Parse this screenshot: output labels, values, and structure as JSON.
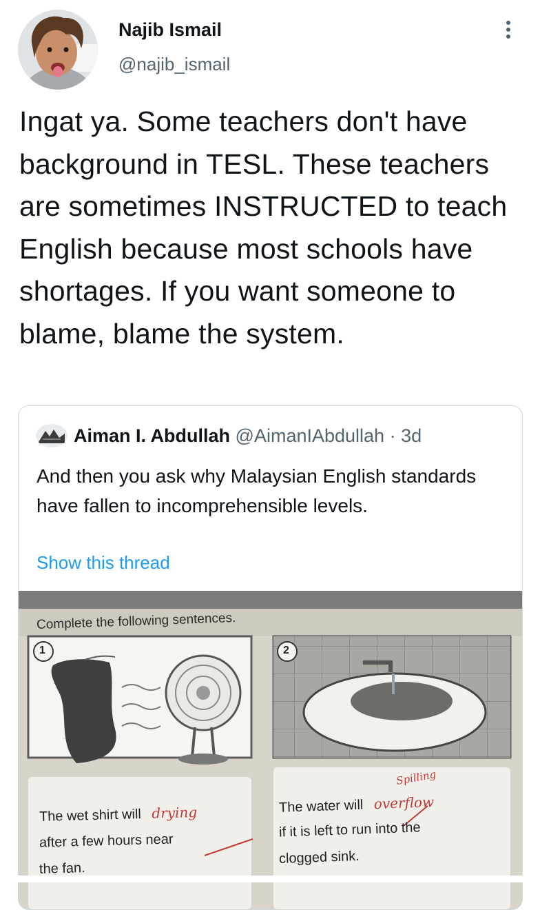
{
  "author": {
    "name": "Najib Ismail",
    "handle": "@najib_ismail"
  },
  "tweet": {
    "text": "Ingat ya. Some teachers don't have background in TESL. These teachers are sometimes INSTRUCTED to teach English because most schools have shortages. If you want someone to blame, blame the system."
  },
  "quoted": {
    "name": "Aiman I. Abdullah",
    "handle": "@AimanIAbdullah",
    "time": "· 3d",
    "text": "And then you ask why Malaysian English standards have fallen to incomprehensible levels.",
    "show_thread": "Show this thread"
  },
  "worksheet": {
    "instruction": "Complete the following sentences.",
    "item1_num": "1",
    "item2_num": "2",
    "s1_a": "The wet shirt will",
    "s1_b": "after a few hours near",
    "s1_c": "the fan.",
    "s1_answer": "drying",
    "s2_a": "The water will",
    "s2_b": "if it is left to run into the",
    "s2_c": "clogged sink.",
    "s2_answer": "overflow",
    "s2_correction": "Spilling"
  },
  "colors": {
    "link": "#1d9bf0",
    "secondary": "#536471",
    "correction": "#c43a3a"
  }
}
